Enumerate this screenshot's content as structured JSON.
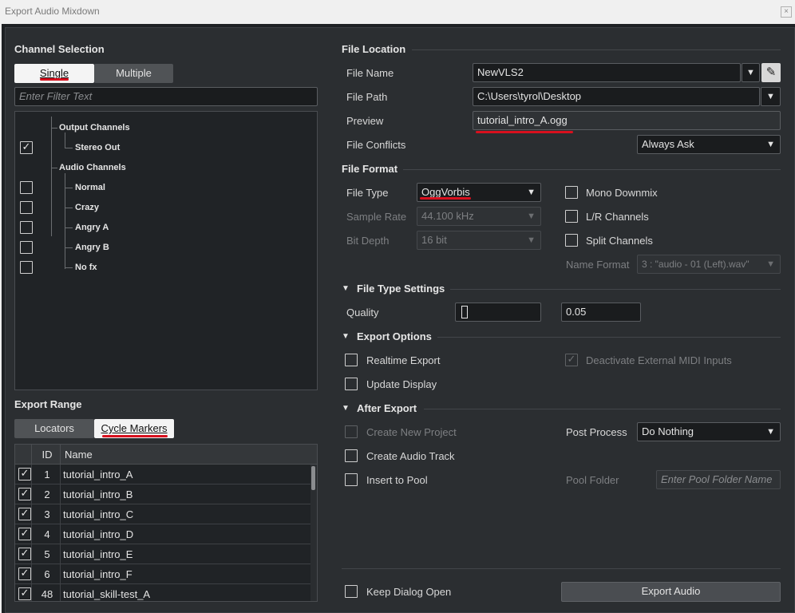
{
  "window": {
    "title": "Export Audio Mixdown",
    "close_glyph": "×"
  },
  "channel_selection": {
    "heading": "Channel Selection",
    "modes": [
      "Single",
      "Multiple"
    ],
    "filter_placeholder": "Enter Filter Text",
    "tree": [
      {
        "label": "Output Channels",
        "type": "group",
        "checked": null
      },
      {
        "label": "Stereo Out",
        "type": "item",
        "checked": true
      },
      {
        "label": "Audio Channels",
        "type": "group",
        "checked": null
      },
      {
        "label": "Normal",
        "type": "item",
        "checked": false
      },
      {
        "label": "Crazy",
        "type": "item",
        "checked": false
      },
      {
        "label": "Angry A",
        "type": "item",
        "checked": false
      },
      {
        "label": "Angry B",
        "type": "item",
        "checked": false
      },
      {
        "label": "No fx",
        "type": "item",
        "checked": false
      }
    ]
  },
  "export_range": {
    "heading": "Export Range",
    "modes": [
      "Locators",
      "Cycle Markers"
    ],
    "columns": [
      "ID",
      "Name"
    ],
    "rows": [
      {
        "id": "1",
        "name": "tutorial_intro_A",
        "checked": true
      },
      {
        "id": "2",
        "name": "tutorial_intro_B",
        "checked": true
      },
      {
        "id": "3",
        "name": "tutorial_intro_C",
        "checked": true
      },
      {
        "id": "4",
        "name": "tutorial_intro_D",
        "checked": true
      },
      {
        "id": "5",
        "name": "tutorial_intro_E",
        "checked": true
      },
      {
        "id": "6",
        "name": "tutorial_intro_F",
        "checked": true
      },
      {
        "id": "48",
        "name": "tutorial_skill-test_A",
        "checked": true
      }
    ]
  },
  "file_location": {
    "heading": "File Location",
    "file_name_label": "File Name",
    "file_name_value": "NewVLS2",
    "file_path_label": "File Path",
    "file_path_value": "C:\\Users\\tyrol\\Desktop",
    "preview_label": "Preview",
    "preview_value": "tutorial_intro_A.ogg",
    "conflicts_label": "File Conflicts",
    "conflicts_value": "Always Ask"
  },
  "file_format": {
    "heading": "File Format",
    "type_label": "File Type",
    "type_value": "OggVorbis",
    "rate_label": "Sample Rate",
    "rate_value": "44.100 kHz",
    "depth_label": "Bit Depth",
    "depth_value": "16 bit",
    "mono_label": "Mono Downmix",
    "lr_label": "L/R Channels",
    "split_label": "Split Channels",
    "name_format_label": "Name Format",
    "name_format_value": "3 : \"audio - 01 (Left).wav\""
  },
  "file_type_settings": {
    "heading": "File Type Settings",
    "quality_label": "Quality",
    "quality_value": "0.05"
  },
  "export_options": {
    "heading": "Export Options",
    "realtime_label": "Realtime Export",
    "update_label": "Update Display",
    "deactivate_label": "Deactivate External MIDI Inputs"
  },
  "after_export": {
    "heading": "After Export",
    "new_project_label": "Create New Project",
    "audio_track_label": "Create Audio Track",
    "pool_label": "Insert to Pool",
    "post_process_label": "Post Process",
    "post_process_value": "Do Nothing",
    "pool_folder_label": "Pool Folder",
    "pool_folder_placeholder": "Enter Pool Folder Name"
  },
  "footer": {
    "keep_open_label": "Keep Dialog Open",
    "export_button": "Export Audio"
  },
  "glyphs": {
    "check": "✓",
    "dropdown": "▼",
    "collapse": "▼",
    "pencil": "✎"
  },
  "colors": {
    "annotation": "#d8101e",
    "panel": "#2b2e31"
  }
}
